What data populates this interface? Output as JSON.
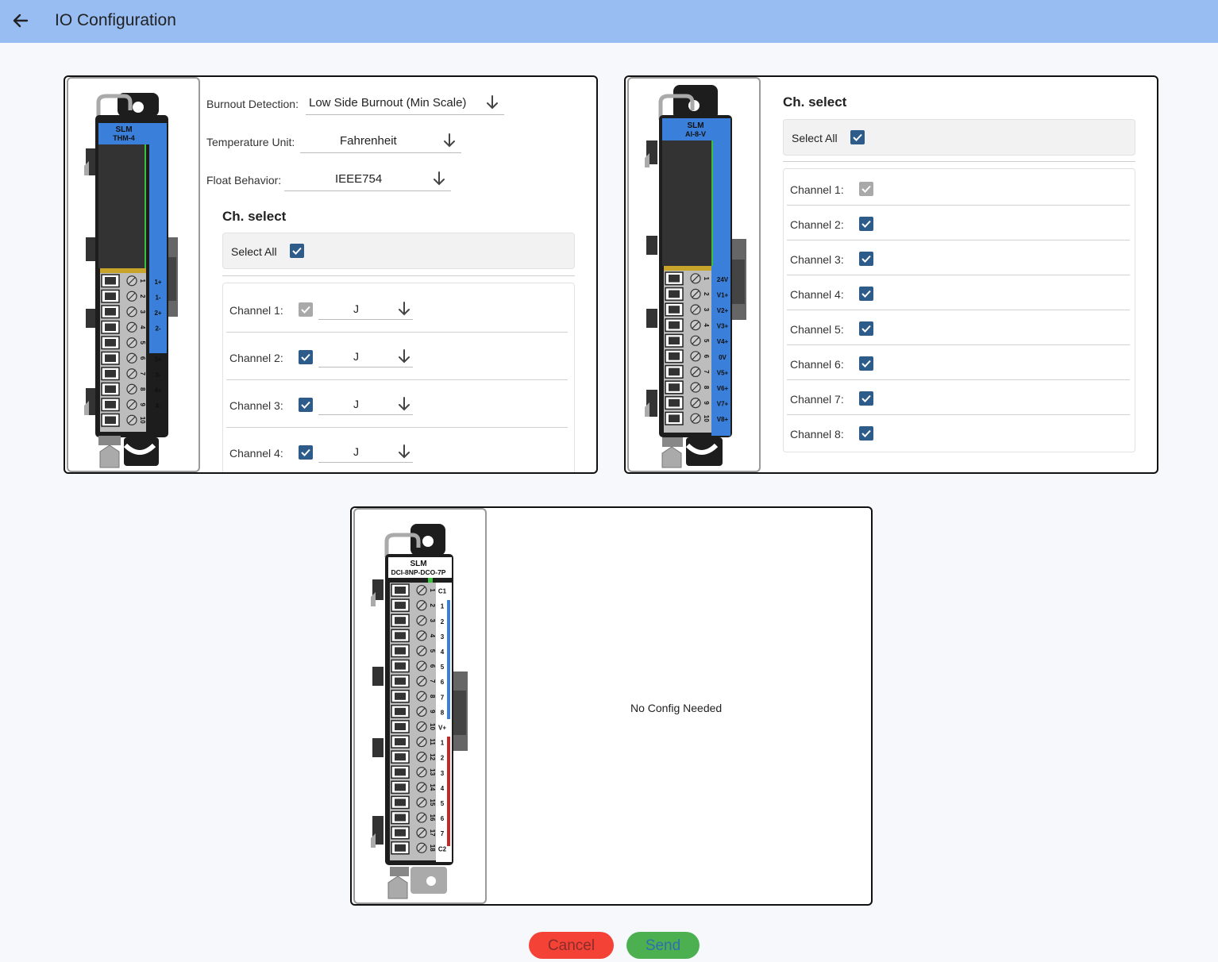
{
  "header": {
    "title": "IO Configuration",
    "back_icon": "arrow-left-icon",
    "bg_color": "#97bdf3"
  },
  "modules": [
    {
      "name": "SLM",
      "model": "THM-4",
      "terminals": [
        "1+",
        "1-",
        "2+",
        "2-",
        "",
        "3+",
        "3-",
        "4+",
        "4-",
        ""
      ],
      "settings": [
        {
          "label": "Burnout Detection:",
          "value": "Low Side Burnout (Min Scale)"
        },
        {
          "label": "Temperature Unit:",
          "value": "Fahrenheit"
        },
        {
          "label": "Float Behavior:",
          "value": "IEEE754"
        }
      ],
      "channel_select_title": "Ch. select",
      "select_all_label": "Select All",
      "select_all_checked": true,
      "channels": [
        {
          "label": "Channel 1:",
          "checked": true,
          "disabled": true,
          "type": "J"
        },
        {
          "label": "Channel 2:",
          "checked": true,
          "disabled": false,
          "type": "J"
        },
        {
          "label": "Channel 3:",
          "checked": true,
          "disabled": false,
          "type": "J"
        },
        {
          "label": "Channel 4:",
          "checked": true,
          "disabled": false,
          "type": "J"
        }
      ]
    },
    {
      "name": "SLM",
      "model": "AI-8-V",
      "terminals": [
        "24V",
        "V1+",
        "V2+",
        "V3+",
        "V4+",
        "0V",
        "V5+",
        "V6+",
        "V7+",
        "V8+"
      ],
      "channel_select_title": "Ch. select",
      "select_all_label": "Select All",
      "select_all_checked": true,
      "channels": [
        {
          "label": "Channel 1:",
          "checked": true,
          "disabled": true
        },
        {
          "label": "Channel 2:",
          "checked": true,
          "disabled": false
        },
        {
          "label": "Channel 3:",
          "checked": true,
          "disabled": false
        },
        {
          "label": "Channel 4:",
          "checked": true,
          "disabled": false
        },
        {
          "label": "Channel 5:",
          "checked": true,
          "disabled": false
        },
        {
          "label": "Channel 6:",
          "checked": true,
          "disabled": false
        },
        {
          "label": "Channel 7:",
          "checked": true,
          "disabled": false
        },
        {
          "label": "Channel 8:",
          "checked": true,
          "disabled": false
        }
      ]
    },
    {
      "name": "SLM",
      "model": "DCI-8NP-DCO-7P",
      "terminals": [
        "C1",
        "1",
        "2",
        "3",
        "4",
        "5",
        "6",
        "7",
        "8",
        "V+",
        "1",
        "2",
        "3",
        "4",
        "5",
        "6",
        "7",
        "C2"
      ],
      "message": "No Config Needed"
    }
  ],
  "actions": {
    "cancel_label": "Cancel",
    "send_label": "Send",
    "cancel_color": "#f44336",
    "send_color": "#4caf50"
  },
  "colors": {
    "accent": "#2d5b8a",
    "module_blue": "#3a7fd9",
    "disabled_check": "#a9a9a9"
  }
}
